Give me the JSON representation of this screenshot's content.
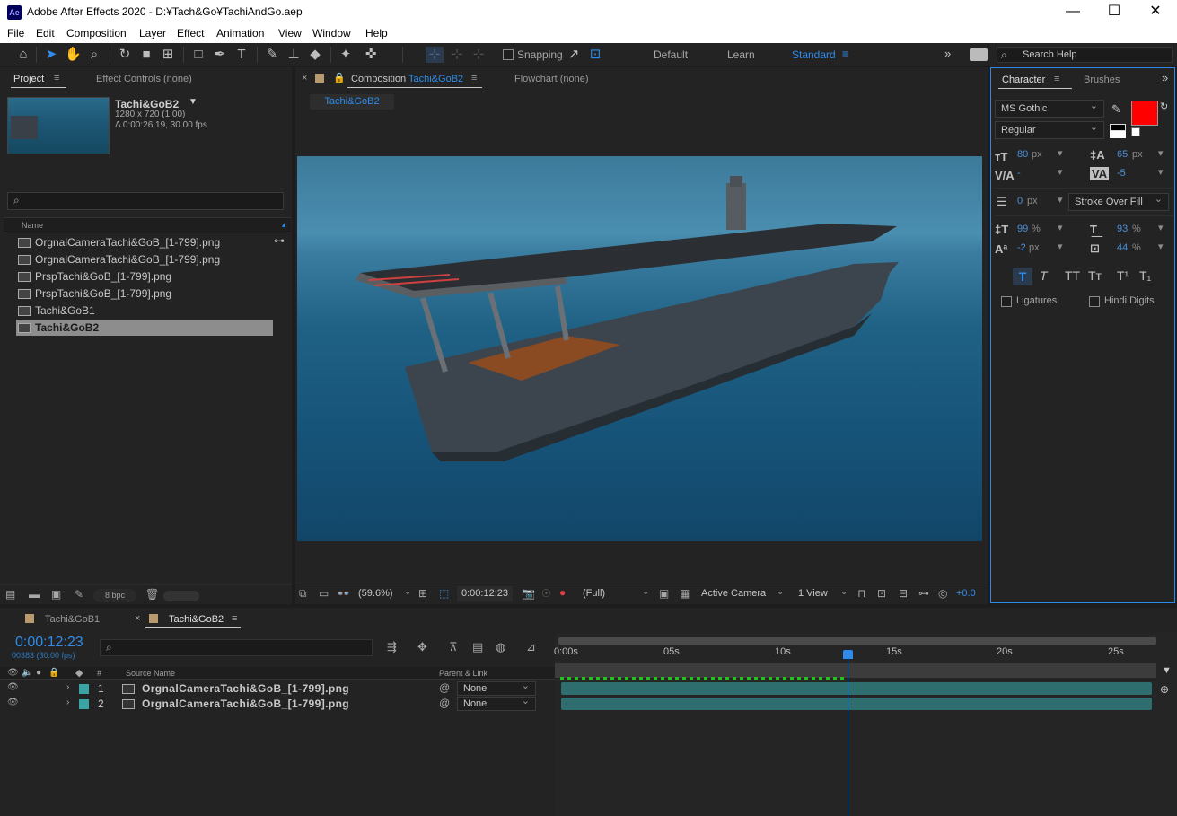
{
  "window": {
    "app_icon": "Ae",
    "title": "Adobe After Effects 2020 - D:¥Tach&Go¥TachiAndGo.aep",
    "minimize": "—",
    "maximize": "☐",
    "close": "✕"
  },
  "menu": [
    "File",
    "Edit",
    "Composition",
    "Layer",
    "Effect",
    "Animation",
    "View",
    "Window",
    "Help"
  ],
  "toolbar": {
    "snapping_label": "Snapping",
    "workspaces": [
      "Default",
      "Learn",
      "Standard"
    ],
    "search_placeholder": "Search Help"
  },
  "project_panel": {
    "tab_project": "Project",
    "tab_effect_controls": "Effect Controls (none)",
    "selected_name": "Tachi&GoB2",
    "selected_dims": "1280 x 720 (1.00)",
    "selected_duration": "Δ 0:00:26:19, 30.00 fps",
    "search_placeholder": "",
    "column_name": "Name",
    "items": [
      {
        "name": "OrgnalCameraTachi&GoB_[1-799].png",
        "selected": false
      },
      {
        "name": "OrgnalCameraTachi&GoB_[1-799].png",
        "selected": false
      },
      {
        "name": "PrspTachi&GoB_[1-799].png",
        "selected": false
      },
      {
        "name": "PrspTachi&GoB_[1-799].png",
        "selected": false
      },
      {
        "name": "Tachi&GoB1",
        "selected": false
      },
      {
        "name": "Tachi&GoB2",
        "selected": true
      }
    ],
    "bpc": "8 bpc"
  },
  "composition_panel": {
    "tab_prefix": "Composition",
    "tab_name": "Tachi&GoB2",
    "tab_flowchart": "Flowchart (none)",
    "breadcrumb": "Tachi&GoB2",
    "zoom": "(59.6%)",
    "timecode": "0:00:12:23",
    "resolution": "(Full)",
    "camera": "Active Camera",
    "views": "1 View",
    "exposure": "+0.0"
  },
  "character_panel": {
    "tab_character": "Character",
    "tab_brushes": "Brushes",
    "font": "MS Gothic",
    "style": "Regular",
    "font_size": "80",
    "leading": "65",
    "kerning": "-",
    "tracking": "-5",
    "stroke_width": "0",
    "stroke_mode": "Stroke Over Fill",
    "vert_scale": "99",
    "horiz_scale": "93",
    "baseline_shift": "-2",
    "tsume": "44",
    "unit_px": "px",
    "unit_pct": "%",
    "fill_color": "#ff0000",
    "ligatures": "Ligatures",
    "hindi_digits": "Hindi Digits",
    "styles": [
      "T",
      "T",
      "TT",
      "Tт",
      "T¹",
      "T₁"
    ]
  },
  "timeline": {
    "tabs": [
      "Tachi&GoB1",
      "Tachi&GoB2"
    ],
    "timecode": "0:00:12:23",
    "frame_info": "00383 (30.00 fps)",
    "col_source": "Source Name",
    "col_parent": "Parent & Link",
    "ruler": [
      "0:00s",
      "05s",
      "10s",
      "15s",
      "20s",
      "25s"
    ],
    "layers": [
      {
        "num": "1",
        "name": "OrgnalCameraTachi&GoB_[1-799].png",
        "parent": "None"
      },
      {
        "num": "2",
        "name": "OrgnalCameraTachi&GoB_[1-799].png",
        "parent": "None"
      }
    ],
    "playhead_fraction": 0.483,
    "layer_color": "#3aa3a3"
  },
  "colors": {
    "accent": "#2d8ceb",
    "panel": "#232323",
    "bg": "#1d1d1d"
  }
}
